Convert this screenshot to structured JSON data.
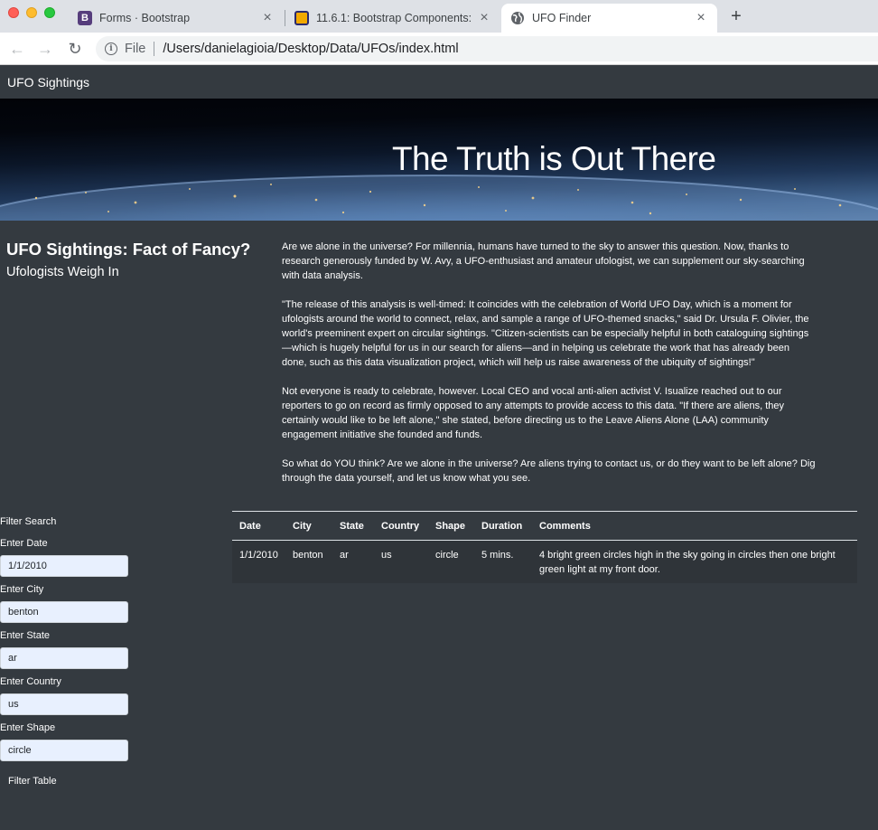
{
  "browser": {
    "tabs": [
      {
        "title": "Forms · Bootstrap",
        "icon": "bootstrap-icon",
        "active": false
      },
      {
        "title": "11.6.1: Bootstrap Components:",
        "icon": "course-icon",
        "active": false
      },
      {
        "title": "UFO Finder",
        "icon": "globe-icon",
        "active": true
      }
    ],
    "new_tab": "+",
    "address_scheme": "File",
    "url": "/Users/danielagioia/Desktop/Data/UFOs/index.html"
  },
  "navbar": {
    "brand": "UFO Sightings"
  },
  "hero": {
    "title": "The Truth is Out There"
  },
  "article": {
    "heading": "UFO Sightings: Fact of Fancy?",
    "subheading": "Ufologists Weigh In",
    "paragraphs": [
      "Are we alone in the universe? For millennia, humans have turned to the sky to answer this question. Now, thanks to research generously funded by W. Avy, a UFO-enthusiast and amateur ufologist, we can supplement our sky-searching with data analysis.",
      "\"The release of this analysis is well-timed: It coincides with the celebration of World UFO Day, which is a moment for ufologists around the world to connect, relax, and sample a range of UFO-themed snacks,\" said Dr. Ursula F. Olivier, the world's preeminent expert on circular sightings. \"Citizen-scientists can be especially helpful in both cataloguing sightings—which is hugely helpful for us in our search for aliens—and in helping us celebrate the work that has already been done, such as this data visualization project, which will help us raise awareness of the ubiquity of sightings!\"",
      "Not everyone is ready to celebrate, however. Local CEO and vocal anti-alien activist V. Isualize reached out to our reporters to go on record as firmly opposed to any attempts to provide access to this data. \"If there are aliens, they certainly would like to be left alone,\" she stated, before directing us to the Leave Aliens Alone (LAA) community engagement initiative she founded and funds.",
      "So what do YOU think? Are we alone in the universe? Are aliens trying to contact us, or do they want to be left alone? Dig through the data yourself, and let us know what you see."
    ]
  },
  "filters": {
    "title": "Filter Search",
    "fields": [
      {
        "label": "Enter Date",
        "value": "1/1/2010"
      },
      {
        "label": "Enter City",
        "value": "benton"
      },
      {
        "label": "Enter State",
        "value": "ar"
      },
      {
        "label": "Enter Country",
        "value": "us"
      },
      {
        "label": "Enter Shape",
        "value": "circle"
      }
    ],
    "button": "Filter Table"
  },
  "table": {
    "headers": [
      "Date",
      "City",
      "State",
      "Country",
      "Shape",
      "Duration",
      "Comments"
    ],
    "rows": [
      [
        "1/1/2010",
        "benton",
        "ar",
        "us",
        "circle",
        "5 mins.",
        "4 bright green circles high in the sky going in circles then one bright green light at my front door."
      ]
    ]
  },
  "colors": {
    "page_bg": "#343a40",
    "row_bg": "#2f3439",
    "input_bg": "#e8f0fe",
    "text": "#ffffff"
  }
}
